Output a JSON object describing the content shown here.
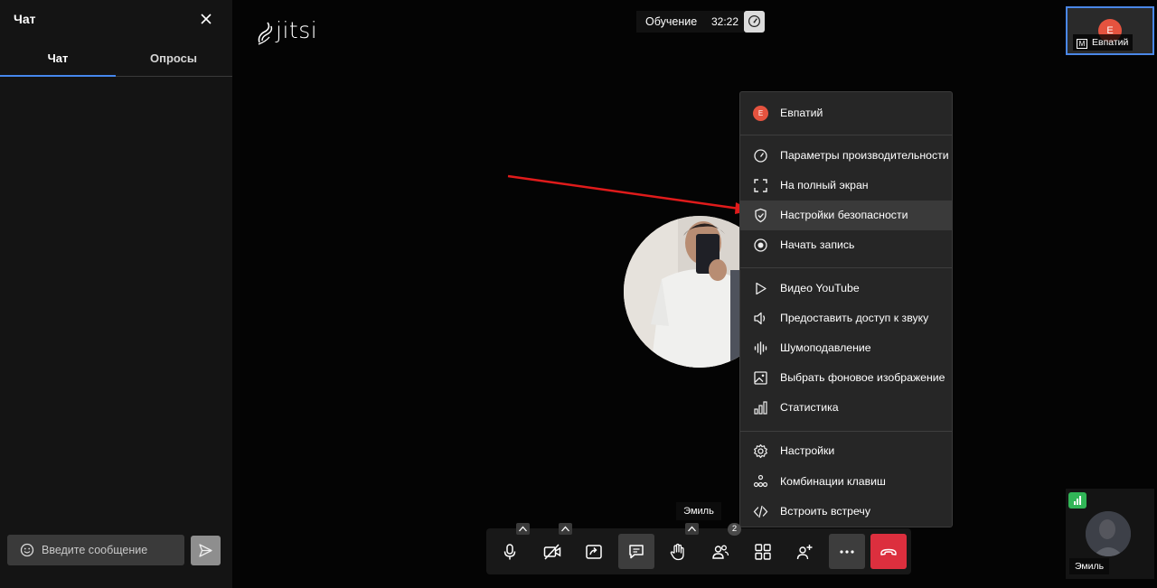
{
  "chat": {
    "title": "Чат",
    "tabs": [
      "Чат",
      "Опросы"
    ],
    "input_placeholder": "Введите сообщение"
  },
  "header": {
    "logo": "jitsi",
    "meeting_title": "Обучение",
    "timer": "32:22"
  },
  "thumbnails": {
    "self": {
      "initial": "E",
      "moderator_mark": "M",
      "name": "Евпатий"
    },
    "other": {
      "name": "Эмиль"
    }
  },
  "speaker_name": "Эмиль",
  "menu": {
    "user": {
      "initial": "E",
      "name": "Евпатий"
    },
    "items": [
      {
        "icon": "gauge-icon",
        "label": "Параметры производительности"
      },
      {
        "icon": "fullscreen-icon",
        "label": "На полный экран"
      },
      {
        "icon": "shield-icon",
        "label": "Настройки безопасности"
      },
      {
        "icon": "record-icon",
        "label": "Начать запись"
      },
      {
        "icon": "play-icon",
        "label": "Видео YouTube"
      },
      {
        "icon": "speaker-icon",
        "label": "Предоставить доступ к звуку"
      },
      {
        "icon": "noise-icon",
        "label": "Шумоподавление"
      },
      {
        "icon": "image-icon",
        "label": "Выбрать фоновое изображение"
      },
      {
        "icon": "stats-icon",
        "label": "Статистика"
      },
      {
        "icon": "gear-icon",
        "label": "Настройки"
      },
      {
        "icon": "keyboard-icon",
        "label": "Комбинации клавиш"
      },
      {
        "icon": "embed-icon",
        "label": "Встроить встречу"
      }
    ]
  },
  "toolbar": {
    "participants_count": "2"
  },
  "colors": {
    "accent": "#4687ed",
    "avatar": "#e5533f",
    "hangup": "#dc2f3e",
    "signal": "#31b557",
    "annotation_arrow": "#e01b1b"
  }
}
